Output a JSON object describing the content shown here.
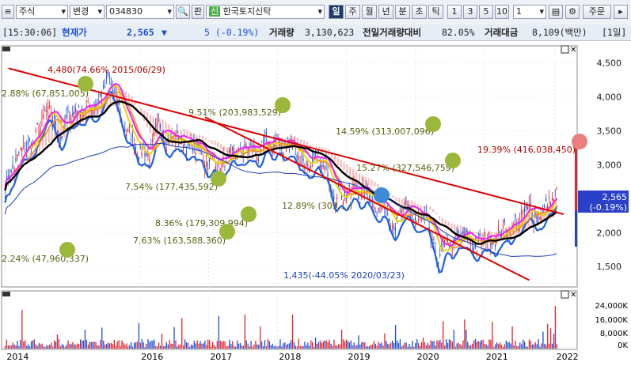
{
  "toolbar": {
    "market_select": "주식",
    "change_select": "변경",
    "code": "034830",
    "search_icon": "search-icon",
    "label_pan": "판",
    "name_badge": "신",
    "name": "한국토지신탁",
    "period_buttons": [
      "일",
      "주",
      "월",
      "년",
      "분",
      "초",
      "틱"
    ],
    "period_selected": "일",
    "num_buttons": [
      "1",
      "3",
      "5",
      "10"
    ],
    "interval_value": "1",
    "save_icon": "save-icon",
    "settings_icon": "gear-icon",
    "order_button": "주문"
  },
  "info": {
    "time": "[15:30:06]",
    "price_label": "현재가",
    "price": "2,565",
    "arrow": "▼",
    "change": "5 (-0.19%)",
    "volume_label": "거래량",
    "volume": "3,130,623",
    "ratio_label": "전일거래량대비",
    "ratio": "82.05%",
    "amount_label": "거래대금",
    "amount": "8,109(백만)",
    "period": "[1일]"
  },
  "annotations": {
    "high": "4,480(74.66% 2015/06/29)",
    "low": "1,435(-44.05% 2020/03/23)",
    "a1": "2.88% (67,851,005)",
    "a2": "9.51% (203,983,529)",
    "a3": "14.59% (313,007,096)",
    "a4": "15.27% (327,546,759)",
    "a5": "19.39% (416,038,450)",
    "a6": "7.54% (177,435,592)",
    "a7": "8.36% (179,309,994)",
    "a8": "7.63% (163,588,360)",
    "a9": "2.24% (47,960,337)",
    "a10": "12.89% (303,...)",
    "current_price_tag": "2,565",
    "current_change_tag": "(-0.19%)"
  },
  "colors": {
    "up": "#e8202a",
    "down": "#1b4fd8",
    "trend": "#e00000",
    "bubble": "#9bb83a",
    "bubble_blue": "#3c8ad8",
    "ma_black": "#000000",
    "ma_pink": "#f020f0",
    "ma_yellow": "#f0d000",
    "ma_orange": "#f09020",
    "cloud": "#f4a0a0"
  },
  "chart_data": {
    "type": "candlestick",
    "x": [
      "2014",
      "2016",
      "2017",
      "2018",
      "2019",
      "2020",
      "2021",
      "2022"
    ],
    "price_axis": [
      "4,500",
      "4,000",
      "3,500",
      "3,000",
      "2,500",
      "2,000",
      "1,500"
    ],
    "volume_axis": [
      "24,000K",
      "16,000K",
      "8,000K",
      "0K"
    ],
    "ylim": [
      1200,
      4750
    ],
    "close_series": [
      [
        2014.0,
        2750
      ],
      [
        2014.2,
        3100
      ],
      [
        2014.4,
        3300
      ],
      [
        2014.6,
        3700
      ],
      [
        2014.8,
        3450
      ],
      [
        2015.0,
        3800
      ],
      [
        2015.3,
        3900
      ],
      [
        2015.5,
        4200
      ],
      [
        2015.7,
        3600
      ],
      [
        2015.9,
        3300
      ],
      [
        2016.1,
        3200
      ],
      [
        2016.3,
        3500
      ],
      [
        2016.5,
        3400
      ],
      [
        2016.7,
        3250
      ],
      [
        2016.9,
        3100
      ],
      [
        2017.1,
        3050
      ],
      [
        2017.3,
        3000
      ],
      [
        2017.5,
        3200
      ],
      [
        2017.7,
        3150
      ],
      [
        2017.9,
        3250
      ],
      [
        2018.1,
        3300
      ],
      [
        2018.3,
        3150
      ],
      [
        2018.5,
        2950
      ],
      [
        2018.7,
        2800
      ],
      [
        2018.9,
        2650
      ],
      [
        2019.1,
        2600
      ],
      [
        2019.3,
        2550
      ],
      [
        2019.5,
        2400
      ],
      [
        2019.7,
        2250
      ],
      [
        2019.9,
        2200
      ],
      [
        2020.1,
        2050
      ],
      [
        2020.25,
        1500
      ],
      [
        2020.4,
        1750
      ],
      [
        2020.6,
        1850
      ],
      [
        2020.8,
        1800
      ],
      [
        2020.95,
        1850
      ],
      [
        2021.1,
        2000
      ],
      [
        2021.3,
        2100
      ],
      [
        2021.5,
        2200
      ],
      [
        2021.7,
        2300
      ],
      [
        2021.85,
        2400
      ],
      [
        2022.0,
        2565
      ]
    ],
    "high_point": {
      "date": "2015/06/29",
      "value": 4480
    },
    "low_point": {
      "date": "2020/03/23",
      "value": 1435
    },
    "current": 2565
  }
}
